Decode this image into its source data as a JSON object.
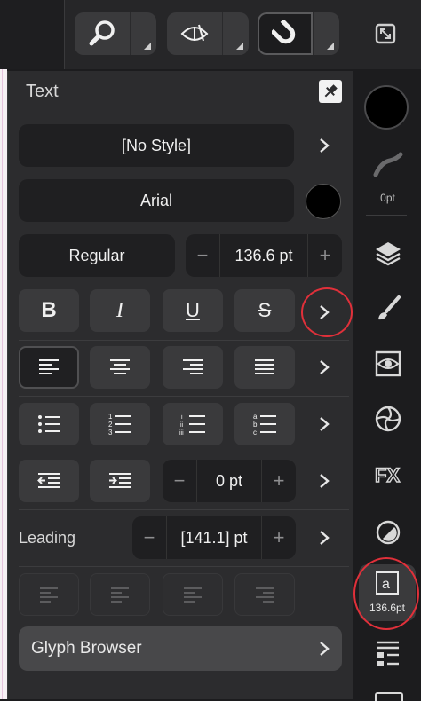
{
  "panel": {
    "title": "Text",
    "style_value": "[No Style]",
    "font_value": "Arial",
    "weight_value": "Regular",
    "font_size_value": "136.6 pt",
    "bold_label": "B",
    "italic_label": "I",
    "underline_label": "U",
    "strike_label": "S",
    "indent_value": "0 pt",
    "leading_label": "Leading",
    "leading_value": "[141.1] pt",
    "glyph_browser_label": "Glyph Browser",
    "minus": "−",
    "plus": "+"
  },
  "sidebar": {
    "stroke_width_label": "0pt",
    "text_style_label": "136.6pt"
  },
  "colors": {
    "font_color": "#000000",
    "fill_color": "#000000",
    "annotation": "#e0303a"
  }
}
